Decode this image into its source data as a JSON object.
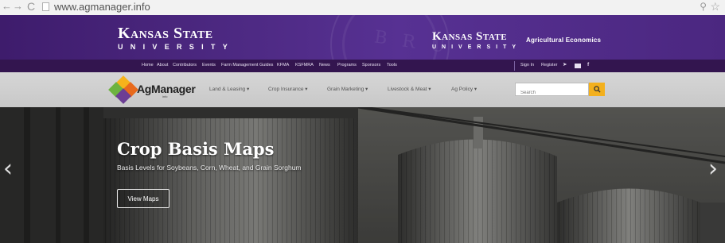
{
  "browser": {
    "url": "www.agmanager.info"
  },
  "header": {
    "left_logo": {
      "name": "Kansas State",
      "sub": "UNIVERSITY"
    },
    "right_logo": {
      "name": "Kansas State",
      "sub": "UNIVERSITY"
    },
    "department": "Agricultural Economics"
  },
  "topnav": {
    "items": [
      "Home",
      "About",
      "Contributors",
      "Events",
      "Farm Management Guides",
      "KFMA",
      "KSFMRA",
      "News",
      "Programs",
      "Sponsors",
      "Tools"
    ],
    "sign_in": "Sign In",
    "register": "Register"
  },
  "sitenav": {
    "brand": "AgManager",
    "brand_sub": "info",
    "menu": [
      "Land & Leasing ▾",
      "Crop Insurance ▾",
      "Grain Marketing ▾",
      "Livestock & Meat ▾",
      "Ag Policy ▾"
    ],
    "search_placeholder": "Search"
  },
  "hero": {
    "title": "Crop Basis Maps",
    "subtitle": "Basis Levels for Soybeans, Corn, Wheat, and Grain Sorghum",
    "button": "View Maps"
  },
  "colors": {
    "purple": "#512888",
    "dark_purple": "#33154f",
    "search_button": "#f3b01d"
  },
  "icons": [
    "back-arrow-icon",
    "forward-arrow-icon",
    "reload-icon",
    "page-icon",
    "zoom-icon",
    "star-icon",
    "twitter-icon",
    "email-icon",
    "facebook-icon",
    "search-icon",
    "chevron-left-icon",
    "chevron-right-icon"
  ]
}
